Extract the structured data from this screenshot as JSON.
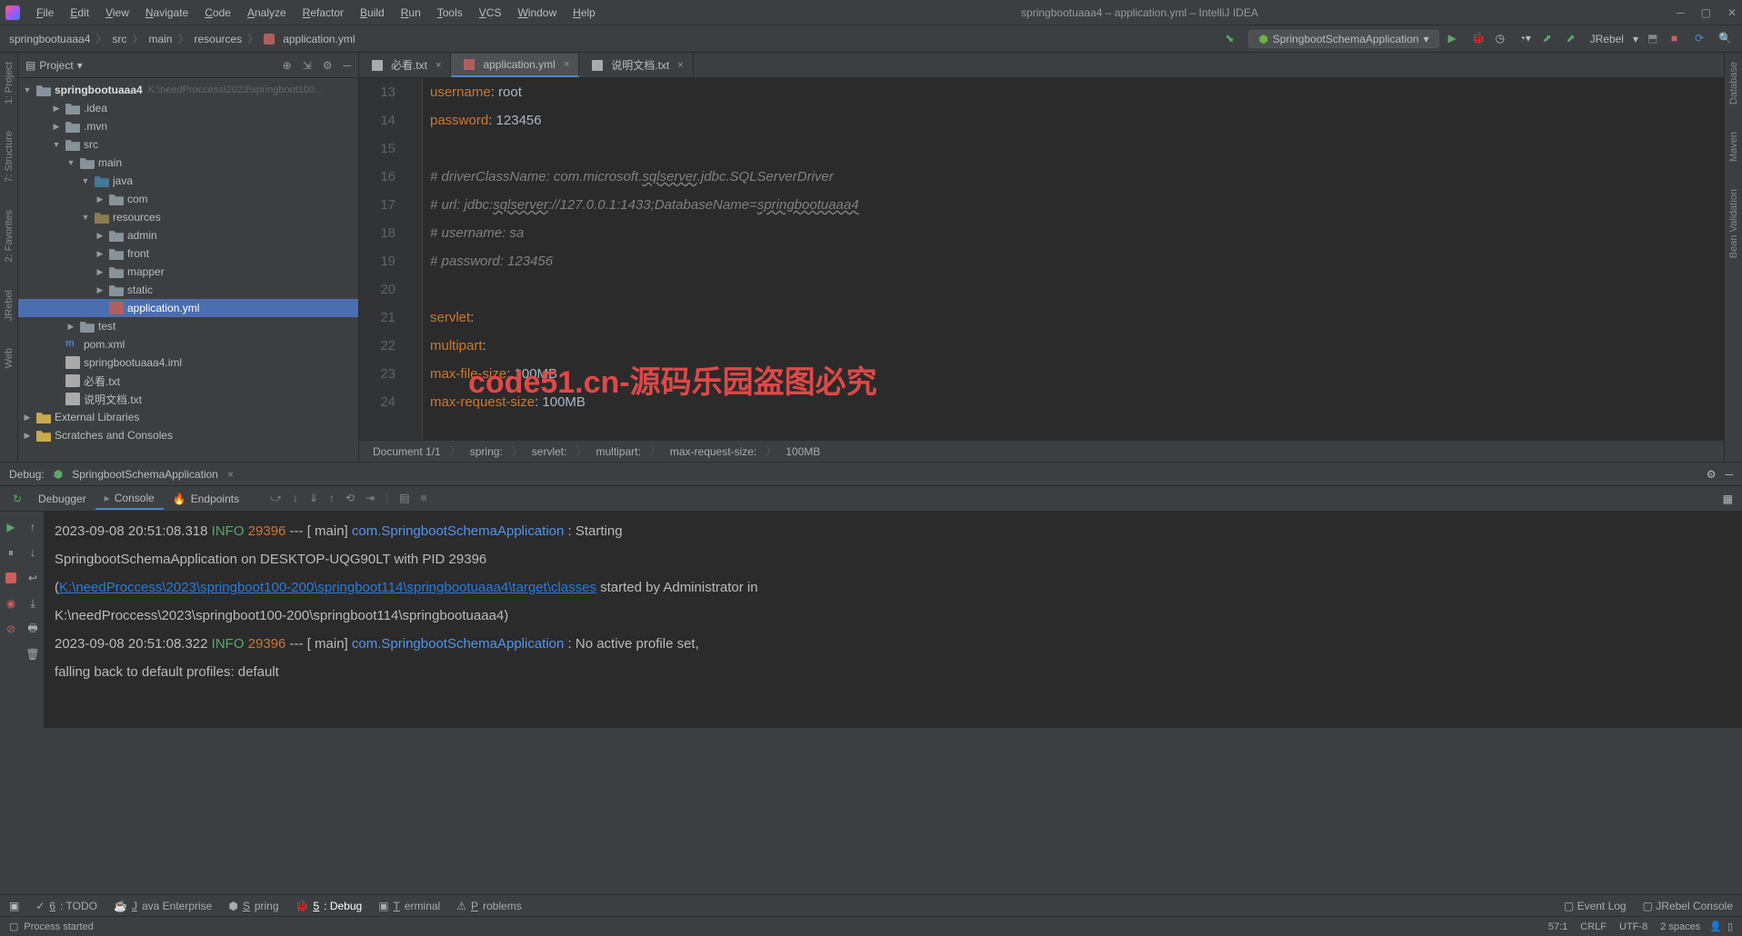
{
  "window": {
    "title": "springbootuaaa4 – application.yml – IntelliJ IDEA"
  },
  "menubar": [
    "File",
    "Edit",
    "View",
    "Navigate",
    "Code",
    "Analyze",
    "Refactor",
    "Build",
    "Run",
    "Tools",
    "VCS",
    "Window",
    "Help"
  ],
  "breadcrumb": [
    "springbootuaaa4",
    "src",
    "main",
    "resources",
    "application.yml"
  ],
  "runConfig": "SpringbootSchemaApplication",
  "toolbarRightExtra": "JRebel",
  "projectPanel": {
    "title": "Project",
    "rootName": "springbootuaaa4",
    "rootPath": "K:\\needProccess\\2023\\springboot100...",
    "tree": [
      {
        "label": ".idea",
        "indent": 2,
        "arrow": "▶",
        "type": "folder"
      },
      {
        "label": ".mvn",
        "indent": 2,
        "arrow": "▶",
        "type": "folder"
      },
      {
        "label": "src",
        "indent": 2,
        "arrow": "▼",
        "type": "folder-module"
      },
      {
        "label": "main",
        "indent": 3,
        "arrow": "▼",
        "type": "folder-module"
      },
      {
        "label": "java",
        "indent": 4,
        "arrow": "▼",
        "type": "folder-java"
      },
      {
        "label": "com",
        "indent": 5,
        "arrow": "▶",
        "type": "folder"
      },
      {
        "label": "resources",
        "indent": 4,
        "arrow": "▼",
        "type": "folder-res"
      },
      {
        "label": "admin",
        "indent": 5,
        "arrow": "▶",
        "type": "folder"
      },
      {
        "label": "front",
        "indent": 5,
        "arrow": "▶",
        "type": "folder"
      },
      {
        "label": "mapper",
        "indent": 5,
        "arrow": "▶",
        "type": "folder"
      },
      {
        "label": "static",
        "indent": 5,
        "arrow": "▶",
        "type": "folder"
      },
      {
        "label": "application.yml",
        "indent": 5,
        "arrow": "",
        "type": "yml",
        "selected": true
      },
      {
        "label": "test",
        "indent": 3,
        "arrow": "▶",
        "type": "folder-module"
      },
      {
        "label": "pom.xml",
        "indent": 2,
        "arrow": "",
        "type": "maven"
      },
      {
        "label": "springbootuaaa4.iml",
        "indent": 2,
        "arrow": "",
        "type": "file"
      },
      {
        "label": "必看.txt",
        "indent": 2,
        "arrow": "",
        "type": "file"
      },
      {
        "label": "说明文档.txt",
        "indent": 2,
        "arrow": "",
        "type": "file"
      }
    ],
    "extLibs": "External Libraries",
    "scratches": "Scratches and Consoles"
  },
  "leftSidebar": [
    "1: Project",
    "7: Structure",
    "2: Favorites",
    "JRebel",
    "Web"
  ],
  "rightSidebar": [
    "Database",
    "Maven",
    "Bean Validation"
  ],
  "editorTabs": [
    {
      "label": "必看.txt",
      "active": false
    },
    {
      "label": "application.yml",
      "active": true
    },
    {
      "label": "说明文档.txt",
      "active": false
    }
  ],
  "code": {
    "lines": [
      {
        "n": 13,
        "html": "        <span class='key'>username</span>: <span class='val'>root</span>"
      },
      {
        "n": 14,
        "html": "        <span class='key'>password</span>: <span class='val'>123456</span>"
      },
      {
        "n": 15,
        "html": ""
      },
      {
        "n": 16,
        "html": "<span class='cm'>#        driverClassName: com.microsoft.<span class='underline'>sqlserver</span>.jdbc.SQLServerDriver</span>"
      },
      {
        "n": 17,
        "html": "<span class='cm'>#        url: jdbc:<span class='underline'>sqlserver</span>://127.0.0.1:1433;DatabaseName=<span class='underline'>springbootuaaa4</span></span>"
      },
      {
        "n": 18,
        "html": "<span class='cm'>#        username: sa</span>"
      },
      {
        "n": 19,
        "html": "<span class='cm'>#        password: 123456</span>"
      },
      {
        "n": 20,
        "html": ""
      },
      {
        "n": 21,
        "html": "    <span class='key'>servlet</span>:"
      },
      {
        "n": 22,
        "html": "      <span class='key'>multipart</span>:"
      },
      {
        "n": 23,
        "html": "        <span class='key'>max-file-size</span>: <span class='val'>100MB</span>"
      },
      {
        "n": 24,
        "html": "        <span class='key'>max-request-size</span>: <span class='val'>100MB</span>"
      }
    ]
  },
  "editorBreadcrumb": [
    "Document 1/1",
    "spring:",
    "servlet:",
    "multipart:",
    "max-request-size:",
    "100MB"
  ],
  "watermarkOverlay": "code51.cn-源码乐园盗图必究",
  "debug": {
    "title": "Debug:",
    "config": "SpringbootSchemaApplication",
    "tabs": [
      "Debugger",
      "Console",
      "Endpoints"
    ],
    "activeTab": 1,
    "console": [
      {
        "t1": "2023-09-08 20:51:08.318  ",
        "lvl": "INFO",
        "pid": " 29396 ",
        "t2": "--- [           main] ",
        "cls": "com.SpringbootSchemaApplication",
        "t3": "            : Starting"
      },
      {
        "plain": "SpringbootSchemaApplication on DESKTOP-UQG90LT with PID 29396"
      },
      {
        "t1": "(",
        "path": "K:\\needProccess\\2023\\springboot100-200\\springboot114\\springbootuaaa4\\target\\classes",
        "t2": " started by Administrator in"
      },
      {
        "plain": "K:\\needProccess\\2023\\springboot100-200\\springboot114\\springbootuaaa4)"
      },
      {
        "t1": "2023-09-08 20:51:08.322  ",
        "lvl": "INFO",
        "pid": " 29396 ",
        "t2": "--- [           main] ",
        "cls": "com.SpringbootSchemaApplication",
        "t3": "            : No active profile set,"
      },
      {
        "plain": "falling back to default profiles: default"
      }
    ]
  },
  "bottomBar": {
    "tabs": [
      "6: TODO",
      "Java Enterprise",
      "Spring",
      "5: Debug",
      "Terminal",
      "Problems"
    ],
    "activeIndex": 3,
    "right": [
      "Event Log",
      "JRebel Console"
    ]
  },
  "statusBar": {
    "left": "Process started",
    "right": [
      "57:1",
      "CRLF",
      "UTF-8",
      "2 spaces"
    ]
  }
}
